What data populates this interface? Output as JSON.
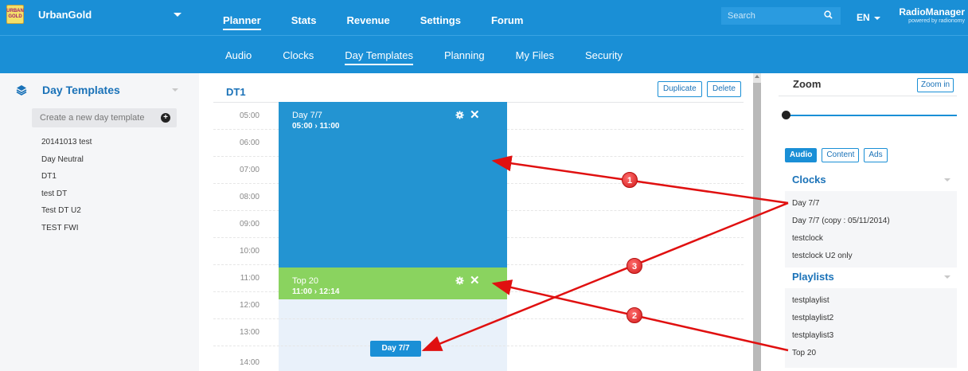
{
  "brand": {
    "name": "UrbanGold",
    "logo_text": "URBAN GOLD"
  },
  "main_nav": [
    {
      "label": "Planner",
      "active": true
    },
    {
      "label": "Stats",
      "active": false
    },
    {
      "label": "Revenue",
      "active": false
    },
    {
      "label": "Settings",
      "active": false
    },
    {
      "label": "Forum",
      "active": false
    }
  ],
  "search": {
    "placeholder": "Search"
  },
  "language": "EN",
  "product": {
    "title": "RadioManager",
    "subtitle": "powered by radionomy"
  },
  "sub_nav": [
    {
      "label": "Audio",
      "active": false
    },
    {
      "label": "Clocks",
      "active": false
    },
    {
      "label": "Day Templates",
      "active": true
    },
    {
      "label": "Planning",
      "active": false
    },
    {
      "label": "My Files",
      "active": false
    },
    {
      "label": "Security",
      "active": false
    }
  ],
  "sidebar": {
    "title": "Day Templates",
    "create_label": "Create a new day template",
    "items": [
      "20141013 test",
      "Day Neutral",
      "DT1",
      "test DT",
      "Test DT U2",
      "TEST FWI"
    ]
  },
  "template": {
    "title": "DT1",
    "duplicate_label": "Duplicate",
    "delete_label": "Delete",
    "times": [
      "05:00",
      "06:00",
      "07:00",
      "08:00",
      "09:00",
      "10:00",
      "11:00",
      "12:00",
      "13:00",
      "14:00"
    ],
    "blocks": [
      {
        "title": "Day 7/7",
        "range": "05:00 › 11:00",
        "color": "#2394d2"
      },
      {
        "title": "Top 20",
        "range": "11:00 › 12:14",
        "color": "#8ad35f"
      }
    ],
    "dragging_label": "Day 7/7"
  },
  "right_panel": {
    "zoom_title": "Zoom",
    "zoom_in_label": "Zoom in",
    "tabs": [
      {
        "label": "Audio",
        "active": true
      },
      {
        "label": "Content",
        "active": false
      },
      {
        "label": "Ads",
        "active": false
      }
    ],
    "clocks_title": "Clocks",
    "clocks": [
      "Day 7/7",
      "Day 7/7 (copy : 05/11/2014)",
      "testclock",
      "testclock U2 only"
    ],
    "playlists_title": "Playlists",
    "playlists": [
      "testplaylist",
      "testplaylist2",
      "testplaylist3",
      "Top 20"
    ]
  },
  "annotations": [
    "1",
    "2",
    "3"
  ],
  "colors": {
    "primary": "#1a8fd6",
    "clock_block": "#2394d2",
    "playlist_block": "#8ad35f",
    "arrow": "#e01010"
  }
}
